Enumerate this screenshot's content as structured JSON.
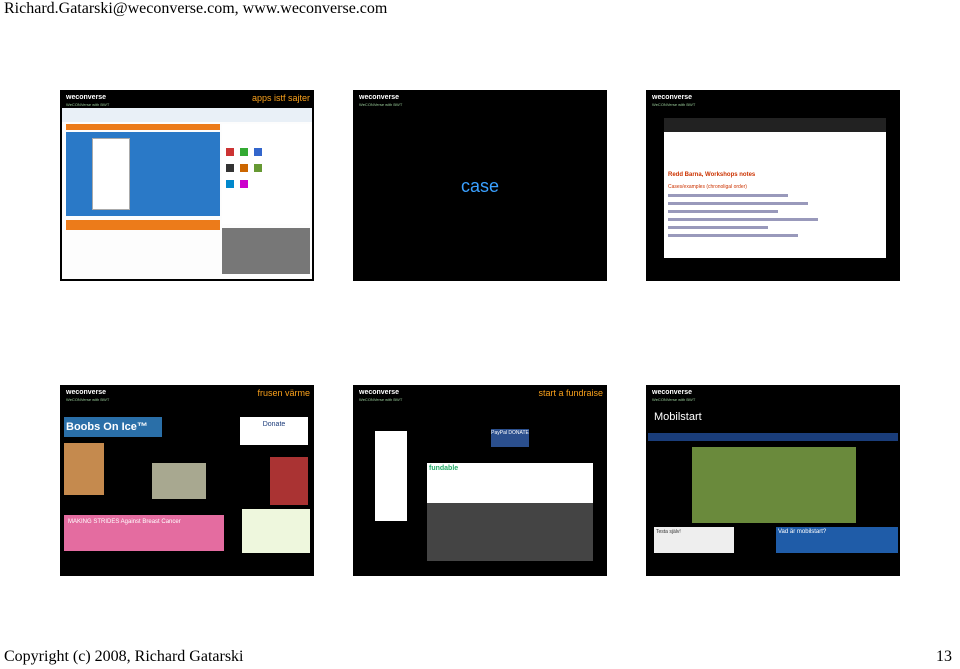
{
  "header": {
    "text": "Richard.Gatarski@weconverse.com, www.weconverse.com"
  },
  "footer": {
    "copyright": "Copyright (c) 2008, Richard Gatarski",
    "page_number": "13"
  },
  "logo": {
    "name": "weconverse",
    "tagline": "WeCONVerse with BWT"
  },
  "slides": [
    {
      "title": "apps istf sajter"
    },
    {
      "title": "case"
    },
    {
      "title": "",
      "wiki": {
        "heading": "Redd Barna, Workshops notes",
        "subheading": "Cases/examples (chronoligal order)"
      }
    },
    {
      "title": "frusen värme",
      "brand": "Boobs On Ice™",
      "donate": "Donate",
      "cause": "MAKING STRIDES Against Breast Cancer"
    },
    {
      "title": "start a fundraise",
      "paypal": "PayPal DONATE",
      "fundable": "fundable"
    },
    {
      "title": "",
      "site": "Mobilstart",
      "question": "Vad är mobilstart?",
      "testa": "Testa själv!"
    }
  ],
  "colors": {
    "accent": "#f9a01b",
    "case": "#3aa0ff",
    "slide_bg": "#000000"
  }
}
